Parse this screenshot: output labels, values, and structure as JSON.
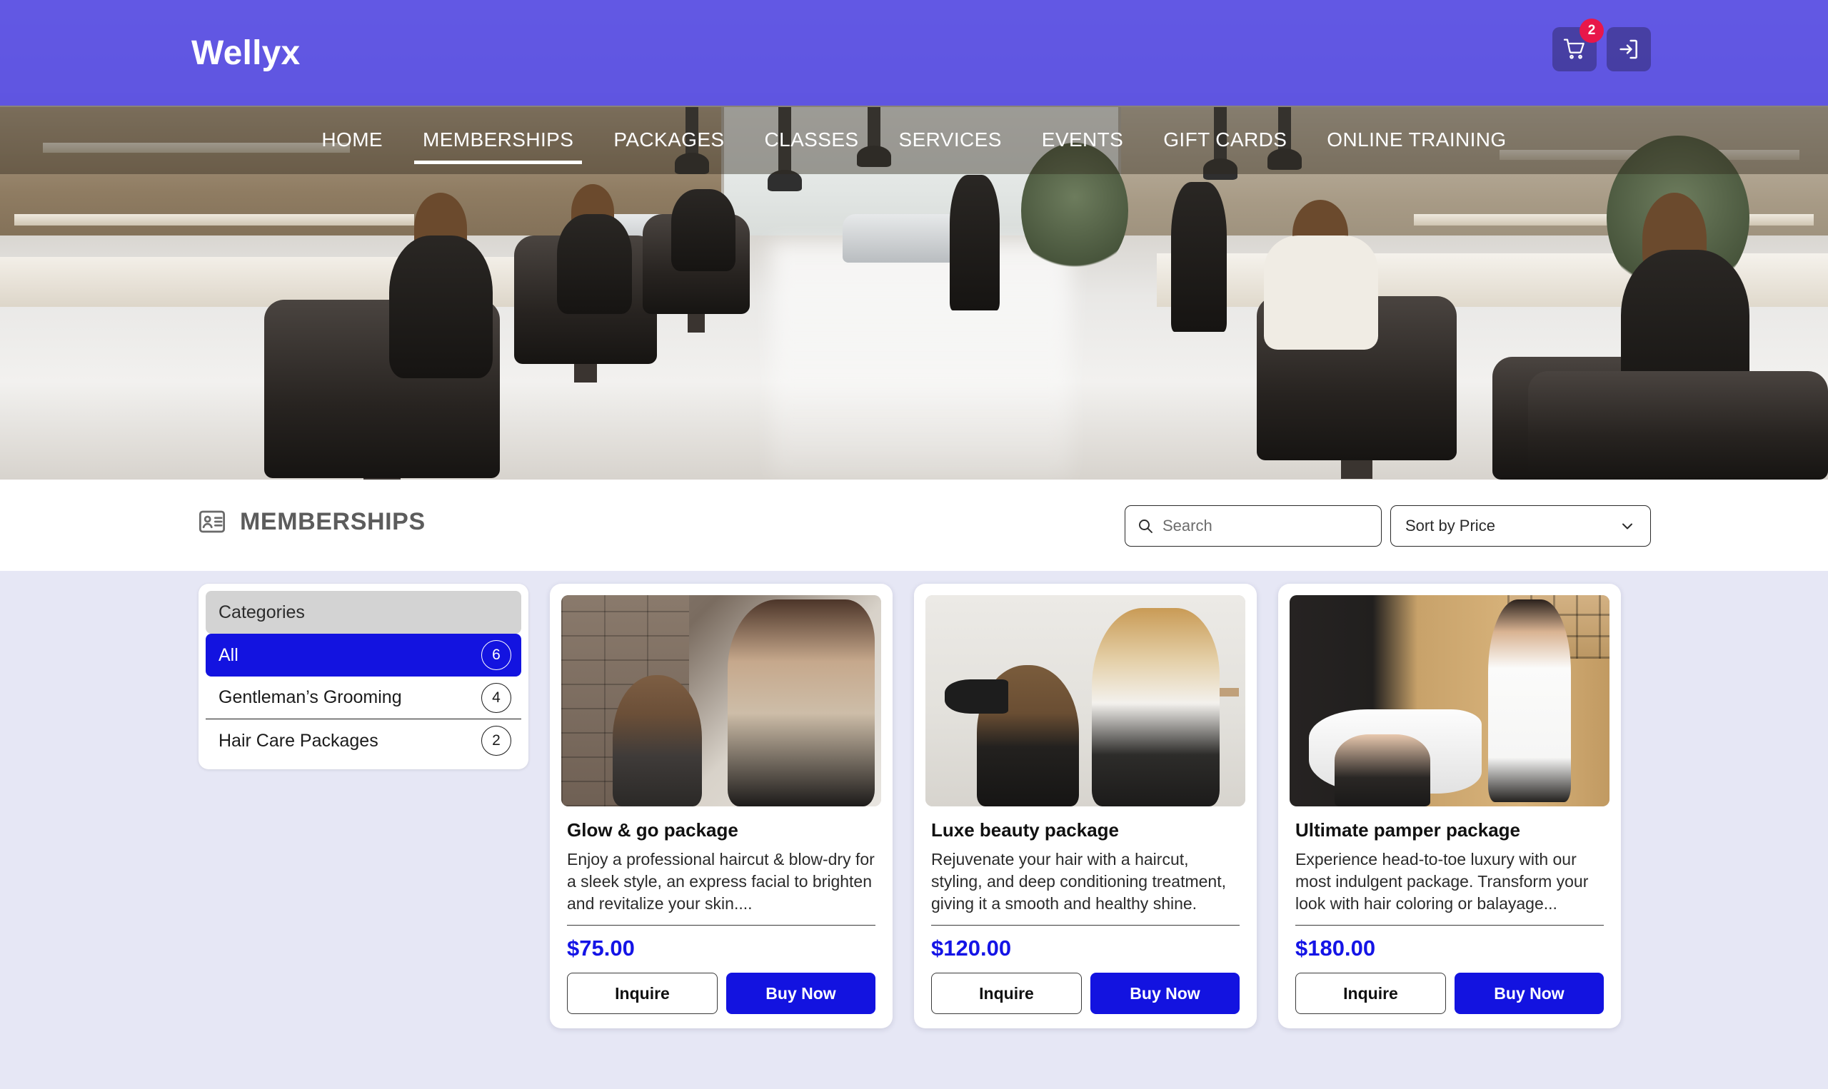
{
  "header": {
    "brand": "Wellyx",
    "cart_icon": "shopping-cart-icon",
    "cart_badge_count": "2",
    "login_icon": "sign-in-icon"
  },
  "nav": {
    "items": [
      {
        "label": "HOME",
        "active": false
      },
      {
        "label": "MEMBERSHIPS",
        "active": true
      },
      {
        "label": "PACKAGES",
        "active": false
      },
      {
        "label": "CLASSES",
        "active": false
      },
      {
        "label": "SERVICES",
        "active": false
      },
      {
        "label": "EVENTS",
        "active": false
      },
      {
        "label": "GIFT CARDS",
        "active": false
      },
      {
        "label": "ONLINE TRAINING",
        "active": false
      }
    ]
  },
  "toolbar": {
    "page_title": "MEMBERSHIPS",
    "title_icon": "id-card-icon",
    "search": {
      "icon": "search-icon",
      "value": "",
      "placeholder": "Search"
    },
    "sort": {
      "label": "Sort by Price",
      "icon": "chevron-down-icon"
    }
  },
  "categories": {
    "heading": "Categories",
    "items": [
      {
        "label": "All",
        "count": "6",
        "active": true
      },
      {
        "label": "Gentleman’s Grooming",
        "count": "4",
        "active": false
      },
      {
        "label": "Hair Care Packages",
        "count": "2",
        "active": false
      }
    ]
  },
  "products": [
    {
      "title": "Glow & go package",
      "description": "Enjoy a professional haircut & blow-dry for a sleek style, an express facial to brighten and revitalize your skin....",
      "price": "$75.00",
      "inquire_label": "Inquire",
      "buy_label": "Buy Now",
      "image_alt": "stylist-cutting-mans-hair"
    },
    {
      "title": "Luxe beauty package",
      "description": "Rejuvenate your hair with a haircut, styling, and deep conditioning treatment, giving it a smooth and healthy shine.",
      "price": "$120.00",
      "inquire_label": "Inquire",
      "buy_label": "Buy Now",
      "image_alt": "stylist-blow-drying-mans-hair"
    },
    {
      "title": "Ultimate pamper package",
      "description": "Experience head-to-toe luxury with our most indulgent package. Transform your look with hair coloring or balayage...",
      "price": "$180.00",
      "inquire_label": "Inquire",
      "buy_label": "Buy Now",
      "image_alt": "barber-washing-womans-hair-at-basin"
    }
  ],
  "colors": {
    "accent_blue": "#1313e0",
    "hero_overlay": "#4338e8",
    "badge_red": "#e8174a",
    "content_bg": "#e6e7f5"
  },
  "hero": {
    "image_alt": "modern-salon-interior-with-stylists-and-clients"
  }
}
